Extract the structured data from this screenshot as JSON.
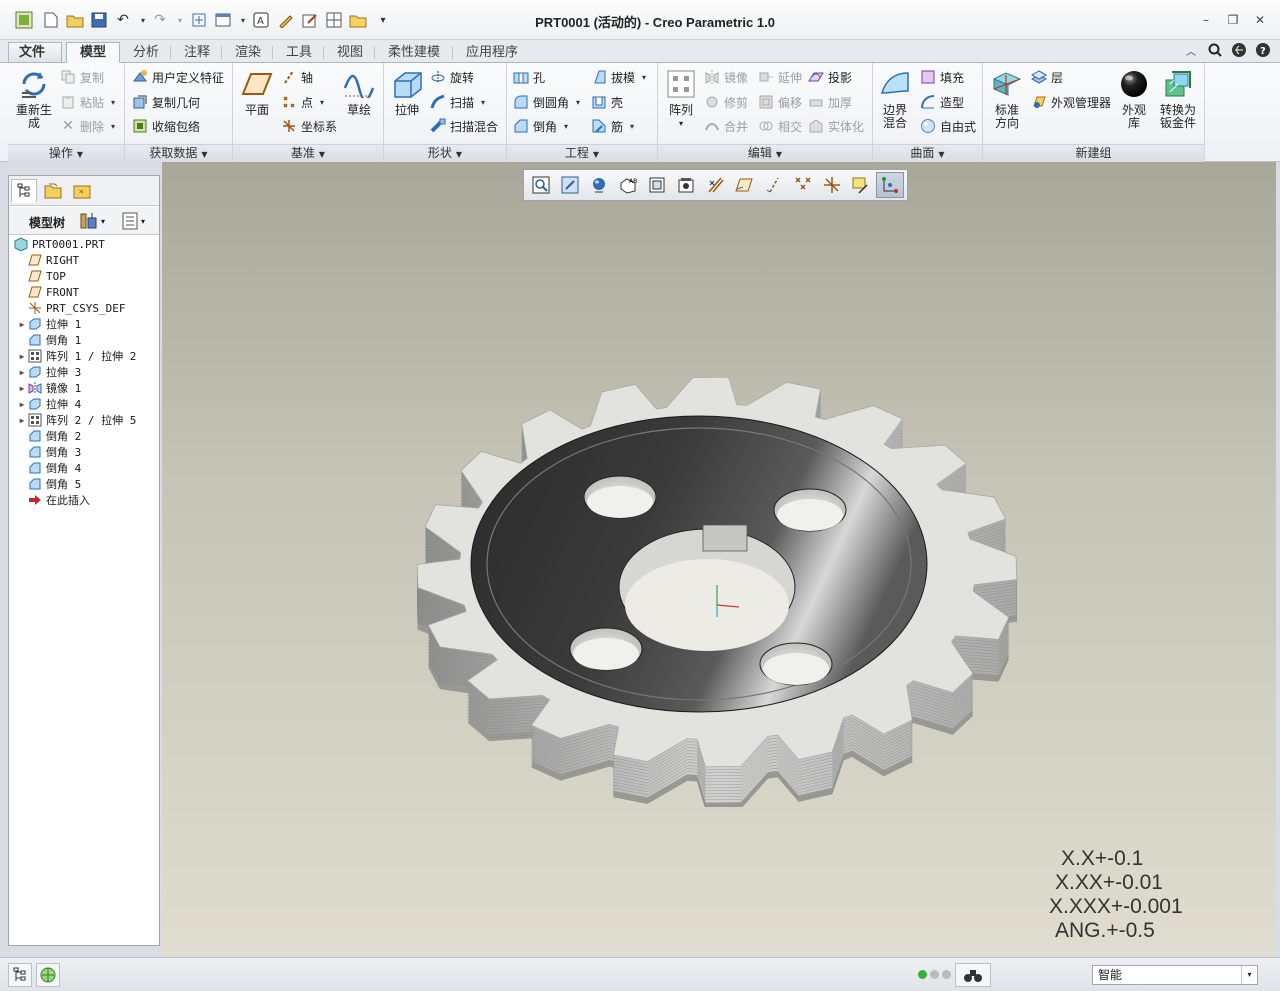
{
  "window": {
    "title": "PRT0001 (活动的) - Creo Parametric 1.0"
  },
  "quick_access": [
    "app-icon",
    "new-icon",
    "open-icon",
    "save-icon",
    "undo-icon",
    "redo-icon",
    "regenerate-icon",
    "window-icon",
    "text-icon",
    "sketch-icon",
    "window-switch-icon",
    "folder-icon",
    "more-icon"
  ],
  "tabs": [
    {
      "label": "文件",
      "caret": "▾"
    },
    {
      "label": "模型"
    },
    {
      "label": "分析"
    },
    {
      "label": "注释"
    },
    {
      "label": "渲染"
    },
    {
      "label": "工具"
    },
    {
      "label": "视图"
    },
    {
      "label": "柔性建模"
    },
    {
      "label": "应用程序"
    }
  ],
  "ribbon": {
    "operations": {
      "label": "操作",
      "regenerate": "重新生\n成",
      "copy": "复制",
      "paste": "粘贴",
      "delete": "删除"
    },
    "get_data": {
      "label": "获取数据",
      "udf": "用户定义特征",
      "copy_geom": "复制几何",
      "shrinkwrap": "收缩包络"
    },
    "datum": {
      "label": "基准",
      "plane": "平面",
      "axis": "轴",
      "point": "点",
      "csys": "坐标系",
      "sketch": "草绘"
    },
    "shapes": {
      "label": "形状",
      "extrude": "拉伸",
      "revolve": "旋转",
      "sweep": "扫描",
      "swept_blend": "扫描混合"
    },
    "engineering": {
      "label": "工程",
      "hole": "孔",
      "round": "倒圆角",
      "chamfer": "倒角",
      "draft": "拔模",
      "shell": "壳",
      "rib": "筋"
    },
    "editing": {
      "label": "编辑",
      "pattern": "阵列",
      "mirror": "镜像",
      "extend": "延伸",
      "project": "投影",
      "trim": "修剪",
      "offset": "偏移",
      "thicken": "加厚",
      "merge": "合并",
      "intersect": "相交",
      "solidify": "实体化"
    },
    "surfaces": {
      "label": "曲面",
      "boundary": "边界\n混合",
      "fill": "填充",
      "style": "造型",
      "freestyle": "自由式"
    },
    "new_group": {
      "label": "新建组",
      "standard": "标准\n方向",
      "layers": "层",
      "appearance_mgr": "外观管理器",
      "appearance_lib": "外观\n库",
      "convert": "转换为\n钣金件"
    }
  },
  "model_tree": {
    "title": "模型树",
    "nodes": [
      {
        "label": "PRT0001.PRT",
        "icon": "part-icon",
        "expandable": false,
        "level": 0
      },
      {
        "label": "RIGHT",
        "icon": "datum-plane-icon",
        "expandable": false,
        "level": 1
      },
      {
        "label": "TOP",
        "icon": "datum-plane-icon",
        "expandable": false,
        "level": 1
      },
      {
        "label": "FRONT",
        "icon": "datum-plane-icon",
        "expandable": false,
        "level": 1
      },
      {
        "label": "PRT_CSYS_DEF",
        "icon": "csys-icon",
        "expandable": false,
        "level": 1
      },
      {
        "label": "拉伸 1",
        "icon": "extrude-icon",
        "expandable": true,
        "level": 1
      },
      {
        "label": "倒角 1",
        "icon": "chamfer-icon",
        "expandable": false,
        "level": 1
      },
      {
        "label": "阵列 1 / 拉伸 2",
        "icon": "pattern-icon",
        "expandable": true,
        "level": 1
      },
      {
        "label": "拉伸 3",
        "icon": "extrude-icon",
        "expandable": true,
        "level": 1
      },
      {
        "label": "镜像 1",
        "icon": "mirror-icon",
        "expandable": true,
        "level": 1
      },
      {
        "label": "拉伸 4",
        "icon": "extrude-icon",
        "expandable": true,
        "level": 1
      },
      {
        "label": "阵列 2 / 拉伸 5",
        "icon": "pattern-icon",
        "expandable": true,
        "level": 1
      },
      {
        "label": "倒角 2",
        "icon": "chamfer-icon",
        "expandable": false,
        "level": 1
      },
      {
        "label": "倒角 3",
        "icon": "chamfer-icon",
        "expandable": false,
        "level": 1
      },
      {
        "label": "倒角 4",
        "icon": "chamfer-icon",
        "expandable": false,
        "level": 1
      },
      {
        "label": "倒角 5",
        "icon": "chamfer-icon",
        "expandable": false,
        "level": 1
      },
      {
        "label": "在此插入",
        "icon": "insert-arrow-icon",
        "expandable": false,
        "level": 1
      }
    ]
  },
  "view_toolbar": [
    "refit-icon",
    "zoom-in-icon",
    "repaint-icon",
    "display-style-icon",
    "saved-views-icon",
    "view-manager-icon",
    "plane-display-icon",
    "axis-display-icon",
    "point-display-icon",
    "csys-display-icon",
    "annotation-display-icon",
    "spin-center-icon",
    "datum-tags-icon"
  ],
  "tolerances": [
    "X.X+-0.1",
    "X.XX+-0.01",
    "X.XXX+-0.001",
    "ANG.+-0.5"
  ],
  "status": {
    "filter_value": "智能"
  },
  "colors": {
    "accent": "#2f6db5",
    "viewport_top": "#a9a799",
    "viewport_bottom": "#e0ddd0"
  }
}
